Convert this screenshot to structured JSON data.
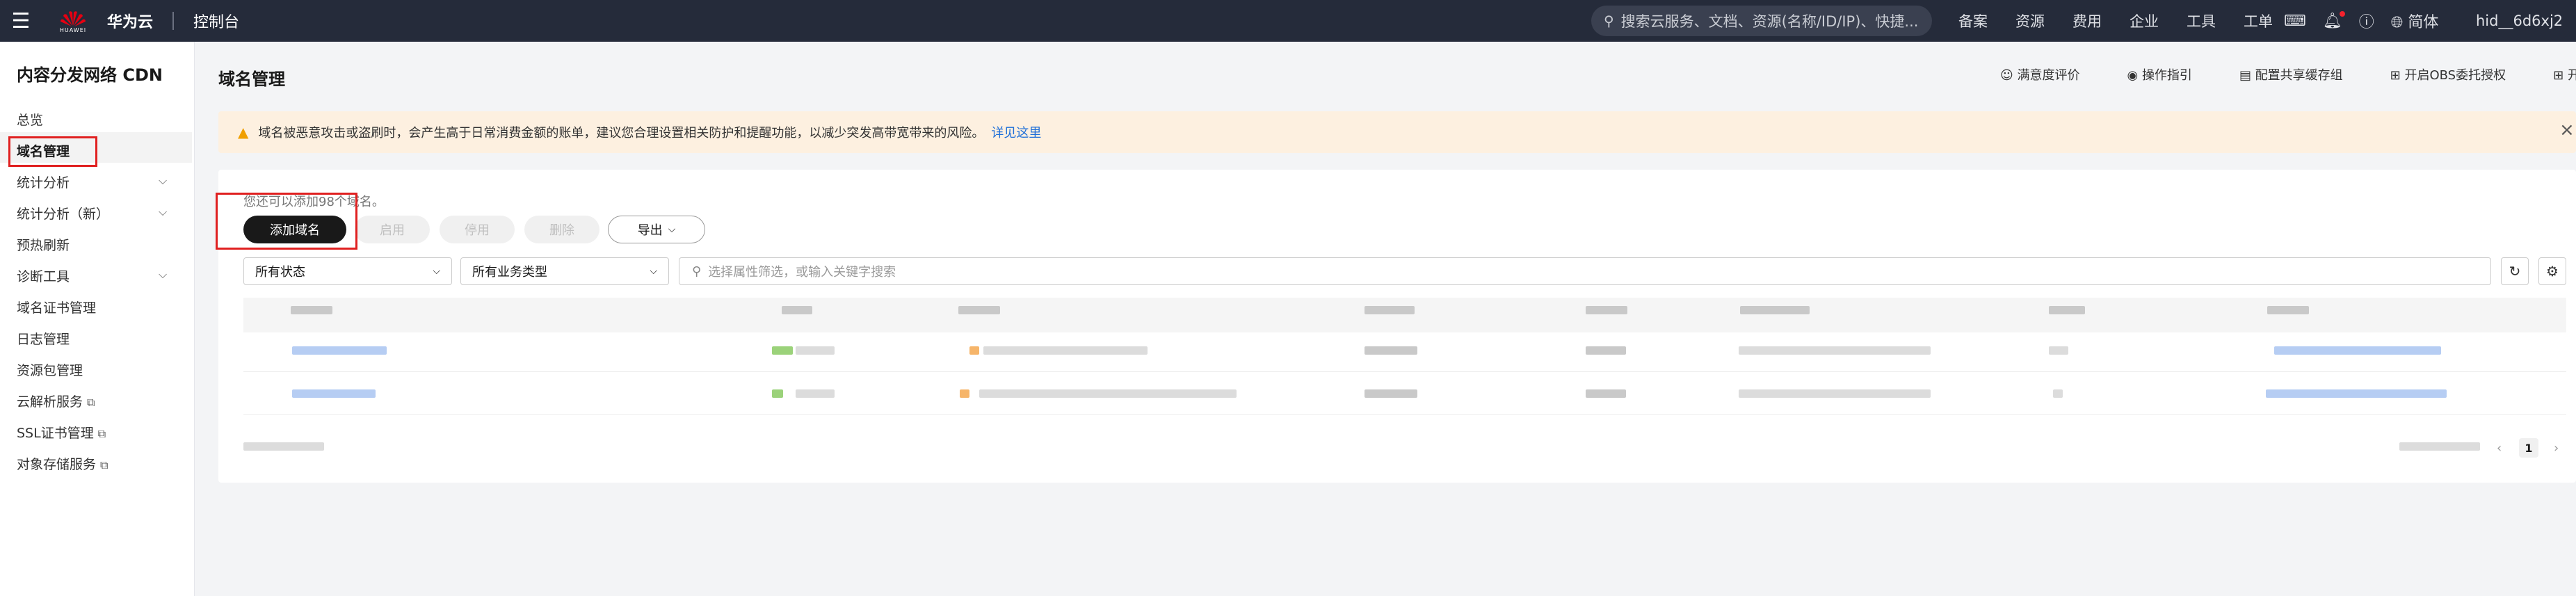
{
  "topbar": {
    "logo_text": "HUAWEI",
    "brand": "华为云",
    "console": "控制台",
    "search_placeholder": "搜索云服务、文档、资源(名称/ID/IP)、快捷...",
    "nav": [
      "备案",
      "资源",
      "费用",
      "企业",
      "工具",
      "工单"
    ],
    "language": "简体",
    "user": "hid__6d6xj2"
  },
  "sidebar": {
    "title": "内容分发网络 CDN",
    "items": [
      {
        "label": "总览",
        "chevron": false,
        "external": false
      },
      {
        "label": "域名管理",
        "chevron": false,
        "external": false,
        "active": true
      },
      {
        "label": "统计分析",
        "chevron": true,
        "external": false
      },
      {
        "label": "统计分析（新）",
        "chevron": true,
        "external": false
      },
      {
        "label": "预热刷新",
        "chevron": false,
        "external": false
      },
      {
        "label": "诊断工具",
        "chevron": true,
        "external": false
      },
      {
        "label": "域名证书管理",
        "chevron": false,
        "external": false
      },
      {
        "label": "日志管理",
        "chevron": false,
        "external": false
      },
      {
        "label": "资源包管理",
        "chevron": false,
        "external": false
      },
      {
        "label": "云解析服务",
        "chevron": false,
        "external": true
      },
      {
        "label": "SSL证书管理",
        "chevron": false,
        "external": true
      },
      {
        "label": "对象存储服务",
        "chevron": false,
        "external": true
      }
    ]
  },
  "page": {
    "title": "域名管理",
    "actions": [
      "满意度评价",
      "操作指引",
      "配置共享缓存组",
      "开启OBS委托授权",
      "开启SCM委托授权"
    ]
  },
  "notice": {
    "text": "域名被恶意攻击或盗刷时，会产生高于日常消费金额的账单，建议您合理设置相关防护和提醒功能，以减少突发高带宽带来的风险。",
    "link": "详见这里"
  },
  "toolbar": {
    "quota": "您还可以添加98个域名。",
    "add": "添加域名",
    "enable": "启用",
    "disable": "停用",
    "delete": "删除",
    "export": "导出"
  },
  "filters": {
    "status": "所有状态",
    "business_type": "所有业务类型",
    "search_placeholder": "选择属性筛选，或输入关键字搜索"
  },
  "pagination": {
    "current": "1"
  },
  "colors": {
    "topbar": "#252b3a",
    "primary_button": "#191919",
    "notice_bg": "#fdf0e0",
    "warning": "#f09f00",
    "link": "#1e6ed8",
    "highlight_box": "#e02020"
  }
}
